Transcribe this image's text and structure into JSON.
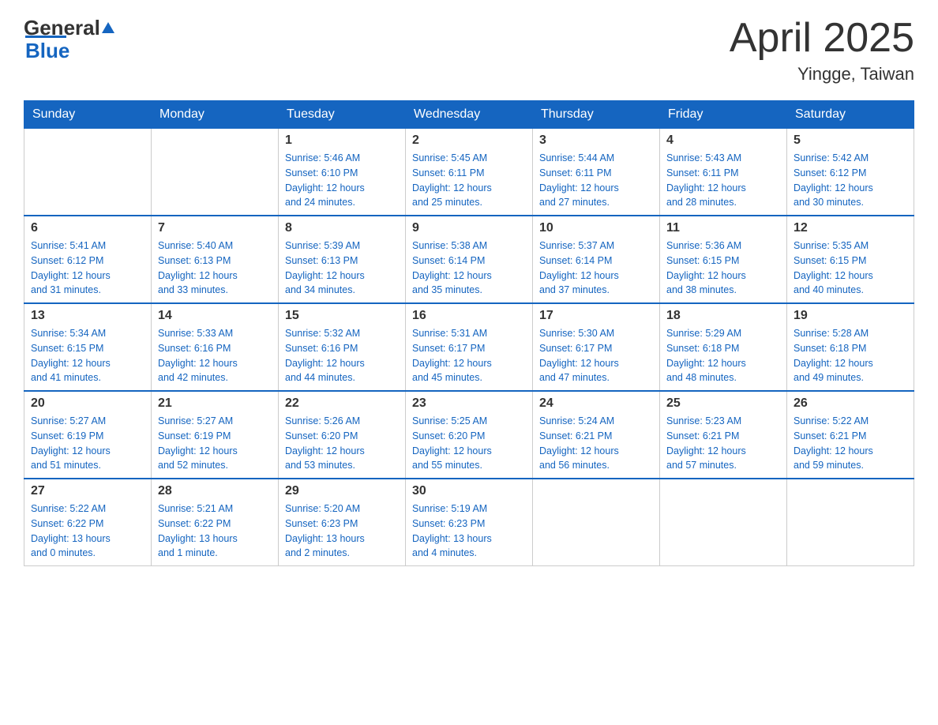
{
  "header": {
    "logo_general": "General",
    "logo_blue": "Blue",
    "month": "April 2025",
    "location": "Yingge, Taiwan"
  },
  "days_of_week": [
    "Sunday",
    "Monday",
    "Tuesday",
    "Wednesday",
    "Thursday",
    "Friday",
    "Saturday"
  ],
  "weeks": [
    [
      {
        "day": "",
        "info": ""
      },
      {
        "day": "",
        "info": ""
      },
      {
        "day": "1",
        "info": "Sunrise: 5:46 AM\nSunset: 6:10 PM\nDaylight: 12 hours\nand 24 minutes."
      },
      {
        "day": "2",
        "info": "Sunrise: 5:45 AM\nSunset: 6:11 PM\nDaylight: 12 hours\nand 25 minutes."
      },
      {
        "day": "3",
        "info": "Sunrise: 5:44 AM\nSunset: 6:11 PM\nDaylight: 12 hours\nand 27 minutes."
      },
      {
        "day": "4",
        "info": "Sunrise: 5:43 AM\nSunset: 6:11 PM\nDaylight: 12 hours\nand 28 minutes."
      },
      {
        "day": "5",
        "info": "Sunrise: 5:42 AM\nSunset: 6:12 PM\nDaylight: 12 hours\nand 30 minutes."
      }
    ],
    [
      {
        "day": "6",
        "info": "Sunrise: 5:41 AM\nSunset: 6:12 PM\nDaylight: 12 hours\nand 31 minutes."
      },
      {
        "day": "7",
        "info": "Sunrise: 5:40 AM\nSunset: 6:13 PM\nDaylight: 12 hours\nand 33 minutes."
      },
      {
        "day": "8",
        "info": "Sunrise: 5:39 AM\nSunset: 6:13 PM\nDaylight: 12 hours\nand 34 minutes."
      },
      {
        "day": "9",
        "info": "Sunrise: 5:38 AM\nSunset: 6:14 PM\nDaylight: 12 hours\nand 35 minutes."
      },
      {
        "day": "10",
        "info": "Sunrise: 5:37 AM\nSunset: 6:14 PM\nDaylight: 12 hours\nand 37 minutes."
      },
      {
        "day": "11",
        "info": "Sunrise: 5:36 AM\nSunset: 6:15 PM\nDaylight: 12 hours\nand 38 minutes."
      },
      {
        "day": "12",
        "info": "Sunrise: 5:35 AM\nSunset: 6:15 PM\nDaylight: 12 hours\nand 40 minutes."
      }
    ],
    [
      {
        "day": "13",
        "info": "Sunrise: 5:34 AM\nSunset: 6:15 PM\nDaylight: 12 hours\nand 41 minutes."
      },
      {
        "day": "14",
        "info": "Sunrise: 5:33 AM\nSunset: 6:16 PM\nDaylight: 12 hours\nand 42 minutes."
      },
      {
        "day": "15",
        "info": "Sunrise: 5:32 AM\nSunset: 6:16 PM\nDaylight: 12 hours\nand 44 minutes."
      },
      {
        "day": "16",
        "info": "Sunrise: 5:31 AM\nSunset: 6:17 PM\nDaylight: 12 hours\nand 45 minutes."
      },
      {
        "day": "17",
        "info": "Sunrise: 5:30 AM\nSunset: 6:17 PM\nDaylight: 12 hours\nand 47 minutes."
      },
      {
        "day": "18",
        "info": "Sunrise: 5:29 AM\nSunset: 6:18 PM\nDaylight: 12 hours\nand 48 minutes."
      },
      {
        "day": "19",
        "info": "Sunrise: 5:28 AM\nSunset: 6:18 PM\nDaylight: 12 hours\nand 49 minutes."
      }
    ],
    [
      {
        "day": "20",
        "info": "Sunrise: 5:27 AM\nSunset: 6:19 PM\nDaylight: 12 hours\nand 51 minutes."
      },
      {
        "day": "21",
        "info": "Sunrise: 5:27 AM\nSunset: 6:19 PM\nDaylight: 12 hours\nand 52 minutes."
      },
      {
        "day": "22",
        "info": "Sunrise: 5:26 AM\nSunset: 6:20 PM\nDaylight: 12 hours\nand 53 minutes."
      },
      {
        "day": "23",
        "info": "Sunrise: 5:25 AM\nSunset: 6:20 PM\nDaylight: 12 hours\nand 55 minutes."
      },
      {
        "day": "24",
        "info": "Sunrise: 5:24 AM\nSunset: 6:21 PM\nDaylight: 12 hours\nand 56 minutes."
      },
      {
        "day": "25",
        "info": "Sunrise: 5:23 AM\nSunset: 6:21 PM\nDaylight: 12 hours\nand 57 minutes."
      },
      {
        "day": "26",
        "info": "Sunrise: 5:22 AM\nSunset: 6:21 PM\nDaylight: 12 hours\nand 59 minutes."
      }
    ],
    [
      {
        "day": "27",
        "info": "Sunrise: 5:22 AM\nSunset: 6:22 PM\nDaylight: 13 hours\nand 0 minutes."
      },
      {
        "day": "28",
        "info": "Sunrise: 5:21 AM\nSunset: 6:22 PM\nDaylight: 13 hours\nand 1 minute."
      },
      {
        "day": "29",
        "info": "Sunrise: 5:20 AM\nSunset: 6:23 PM\nDaylight: 13 hours\nand 2 minutes."
      },
      {
        "day": "30",
        "info": "Sunrise: 5:19 AM\nSunset: 6:23 PM\nDaylight: 13 hours\nand 4 minutes."
      },
      {
        "day": "",
        "info": ""
      },
      {
        "day": "",
        "info": ""
      },
      {
        "day": "",
        "info": ""
      }
    ]
  ]
}
